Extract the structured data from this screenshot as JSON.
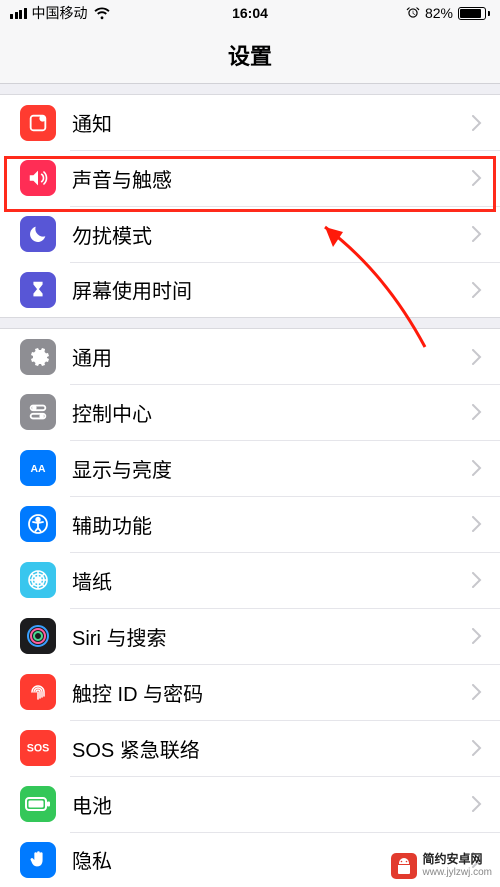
{
  "statusbar": {
    "carrier": "中国移动",
    "time": "16:04",
    "battery_pct": "82%"
  },
  "header": {
    "title": "设置"
  },
  "groups": [
    {
      "rows": [
        {
          "id": "notifications",
          "label": "通知",
          "icon": "notifications-icon",
          "bg": "#ff3b30"
        },
        {
          "id": "sounds",
          "label": "声音与触感",
          "icon": "sounds-icon",
          "bg": "#ff2d55",
          "highlighted": true
        },
        {
          "id": "dnd",
          "label": "勿扰模式",
          "icon": "moon-icon",
          "bg": "#5856d6"
        },
        {
          "id": "screentime",
          "label": "屏幕使用时间",
          "icon": "hourglass-icon",
          "bg": "#5856d6"
        }
      ]
    },
    {
      "rows": [
        {
          "id": "general",
          "label": "通用",
          "icon": "gear-icon",
          "bg": "#8e8e93"
        },
        {
          "id": "control-center",
          "label": "控制中心",
          "icon": "switches-icon",
          "bg": "#8e8e93"
        },
        {
          "id": "display",
          "label": "显示与亮度",
          "icon": "display-icon",
          "bg": "#007aff"
        },
        {
          "id": "accessibility",
          "label": "辅助功能",
          "icon": "accessibility-icon",
          "bg": "#007aff"
        },
        {
          "id": "wallpaper",
          "label": "墙纸",
          "icon": "wallpaper-icon",
          "bg": "#39c6ee"
        },
        {
          "id": "siri",
          "label": "Siri 与搜索",
          "icon": "siri-icon",
          "bg": "#1c1c1e"
        },
        {
          "id": "touchid",
          "label": "触控 ID 与密码",
          "icon": "fingerprint-icon",
          "bg": "#ff3b30"
        },
        {
          "id": "sos",
          "label": "SOS 紧急联络",
          "icon": "sos-icon",
          "bg": "#ff3b30"
        },
        {
          "id": "battery",
          "label": "电池",
          "icon": "battery-icon",
          "bg": "#34c759"
        },
        {
          "id": "privacy",
          "label": "隐私",
          "icon": "hand-icon",
          "bg": "#007aff"
        }
      ]
    }
  ],
  "watermark": {
    "title": "简约安卓网",
    "url": "www.jylzwj.com"
  }
}
